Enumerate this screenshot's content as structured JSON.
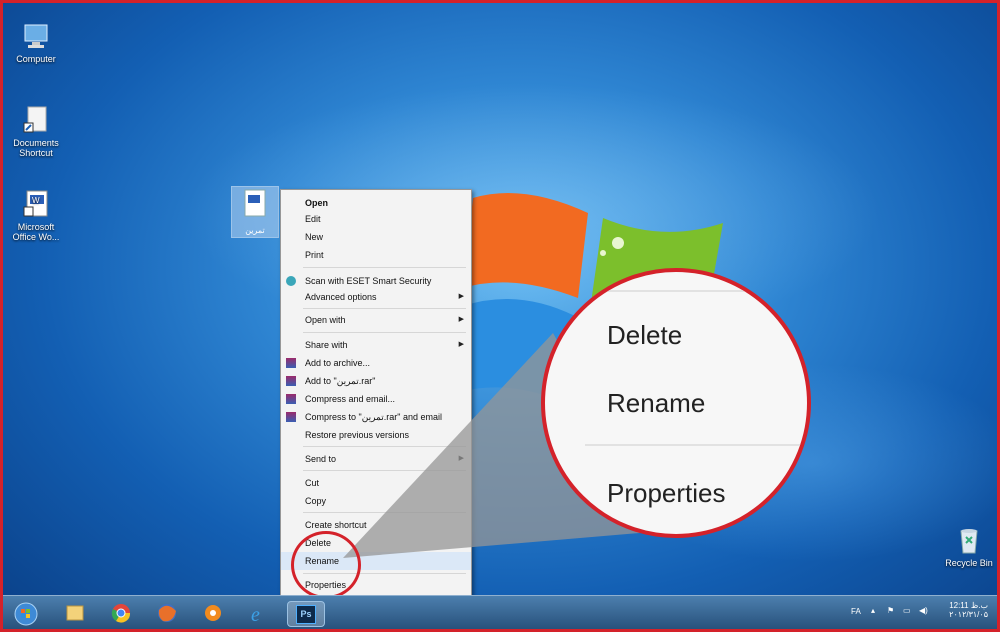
{
  "desktop": {
    "icons": [
      {
        "label": "Computer",
        "icon": "computer-icon"
      },
      {
        "label": "Documents Shortcut",
        "icon": "documents-shortcut-icon"
      },
      {
        "label": "Microsoft Office Wo...",
        "icon": "word-icon"
      },
      {
        "label": "Recycle Bin",
        "icon": "recycle-bin-icon"
      }
    ],
    "selected_file": {
      "label": "تمرین"
    }
  },
  "context_menu": {
    "items": [
      {
        "label": "Open",
        "bold": true
      },
      {
        "label": "Edit"
      },
      {
        "label": "New"
      },
      {
        "label": "Print"
      },
      {
        "label": "Scan with ESET Smart Security",
        "icon": "eset-icon"
      },
      {
        "label": "Advanced options",
        "submenu": true
      },
      {
        "label": "Open with",
        "submenu": true
      },
      {
        "label": "Share with",
        "submenu": true
      },
      {
        "label": "Add to archive...",
        "icon": "winrar-icon"
      },
      {
        "label": "Add to \"تمرین.rar\"",
        "icon": "winrar-icon"
      },
      {
        "label": "Compress and email...",
        "icon": "winrar-icon"
      },
      {
        "label": "Compress to \"تمرین.rar\" and email",
        "icon": "winrar-icon"
      },
      {
        "label": "Restore previous versions"
      },
      {
        "label": "Send to",
        "submenu": true
      },
      {
        "label": "Cut"
      },
      {
        "label": "Copy"
      },
      {
        "label": "Create shortcut"
      },
      {
        "label": "Delete"
      },
      {
        "label": "Rename"
      },
      {
        "label": "Properties"
      }
    ]
  },
  "magnifier": {
    "items": [
      "Delete",
      "Rename",
      "Properties"
    ]
  },
  "taskbar": {
    "apps": [
      "start-orb-icon",
      "file-explorer-icon",
      "chrome-icon",
      "firefox-icon",
      "media-player-icon",
      "internet-explorer-icon",
      "photoshop-icon"
    ],
    "photoshop_label": "Ps",
    "language": "FA",
    "clock_time": "12:11 ب.ظ",
    "clock_date": "۲۰۱۲/۳۱/۰۵"
  },
  "colors": {
    "highlight": "#d4222a",
    "accent": "#1f6fc0"
  }
}
